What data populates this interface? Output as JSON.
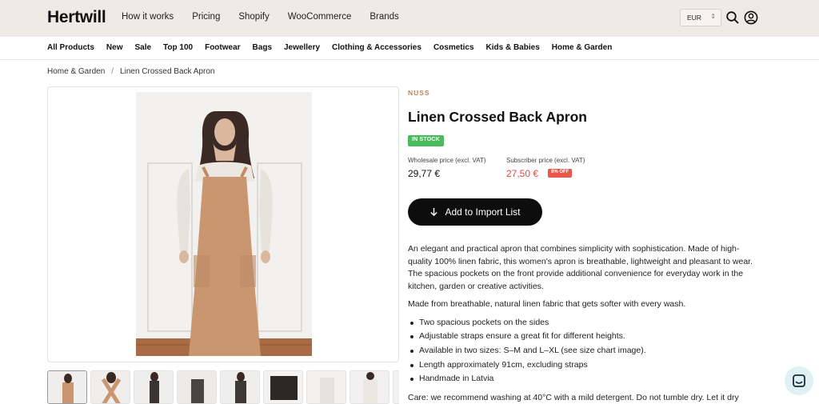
{
  "header": {
    "logo": "Hertwill",
    "nav": [
      "How it works",
      "Pricing",
      "Shopify",
      "WooCommerce",
      "Brands"
    ],
    "currency": "EUR",
    "icons": [
      "search-icon",
      "account-icon"
    ]
  },
  "categories": [
    "All Products",
    "New",
    "Sale",
    "Top 100",
    "Footwear",
    "Bags",
    "Jewellery",
    "Clothing & Accessories",
    "Cosmetics",
    "Kids & Babies",
    "Home & Garden"
  ],
  "breadcrumb": {
    "parent": "Home & Garden",
    "separator": "/",
    "current": "Linen Crossed Back Apron"
  },
  "product": {
    "brand": "NUSS",
    "title": "Linen Crossed Back Apron",
    "stock": "IN STOCK",
    "wholesale_label": "Wholesale price (excl. VAT)",
    "wholesale_price": "29,77 €",
    "subscriber_label": "Subscriber price (excl. VAT)",
    "subscriber_price": "27,50 €",
    "discount": "8% OFF",
    "import_button": "Add to Import List",
    "description": [
      "An elegant and practical apron that combines simplicity with sophistication. Made of high-quality 100% linen fabric, this women's apron is breathable, lightweight and pleasant to wear. The spacious pockets on the front provide additional convenience for everyday work in the kitchen, garden or creative activities.",
      "Made from breathable, natural linen fabric that gets softer with every wash."
    ],
    "features": [
      "Two spacious pockets on the sides",
      "Adjustable straps ensure a great fit for different heights.",
      "Available in two sizes: S–M and L–XL (see size chart image).",
      "Length approximately 91cm, excluding straps",
      "Handmade in Latvia"
    ],
    "care": "Care: we recommend washing at 40°C with a mild detergent. Do not tumble dry. Let it dry"
  },
  "colors": {
    "accent_brand": "#b8895a",
    "stock_green": "#4aba5e",
    "price_red": "#e04a3c",
    "topbar_bg": "#eeeae6"
  }
}
